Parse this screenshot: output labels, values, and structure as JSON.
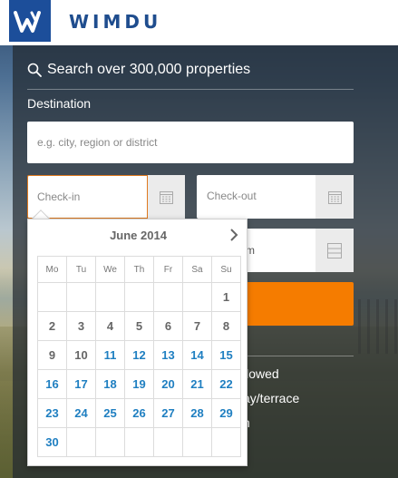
{
  "header": {
    "brand": "WIMDU"
  },
  "search": {
    "title": "Search over 300,000 properties",
    "destination_label": "Destination",
    "destination_placeholder": "e.g. city, region or district",
    "checkin_placeholder": "Check-in",
    "checkout_placeholder": "Check-out",
    "guests_partial_text": "m"
  },
  "filters": [
    "llowed",
    "ay/terrace",
    "n"
  ],
  "calendar": {
    "month_label": "June 2014",
    "weekdays": [
      "Mo",
      "Tu",
      "We",
      "Th",
      "Fr",
      "Sa",
      "Su"
    ],
    "weeks": [
      [
        "",
        "",
        "",
        "",
        "",
        "",
        "1"
      ],
      [
        "2",
        "3",
        "4",
        "5",
        "6",
        "7",
        "8"
      ],
      [
        "9",
        "10",
        "11",
        "12",
        "13",
        "14",
        "15"
      ],
      [
        "16",
        "17",
        "18",
        "19",
        "20",
        "21",
        "22"
      ],
      [
        "23",
        "24",
        "25",
        "26",
        "27",
        "28",
        "29"
      ],
      [
        "30",
        "",
        "",
        "",
        "",
        "",
        ""
      ]
    ],
    "first_available_day": 11
  },
  "colors": {
    "brand_blue": "#1c4e9a",
    "accent_orange": "#f57c00",
    "available_day": "#1f7fc1",
    "unavailable_day": "#666666"
  },
  "icons": {
    "logo": "wimdu-logo-icon",
    "search": "search-icon",
    "calendar": "calendar-icon",
    "guests": "list-icon",
    "next_month": "chevron-right-icon"
  }
}
